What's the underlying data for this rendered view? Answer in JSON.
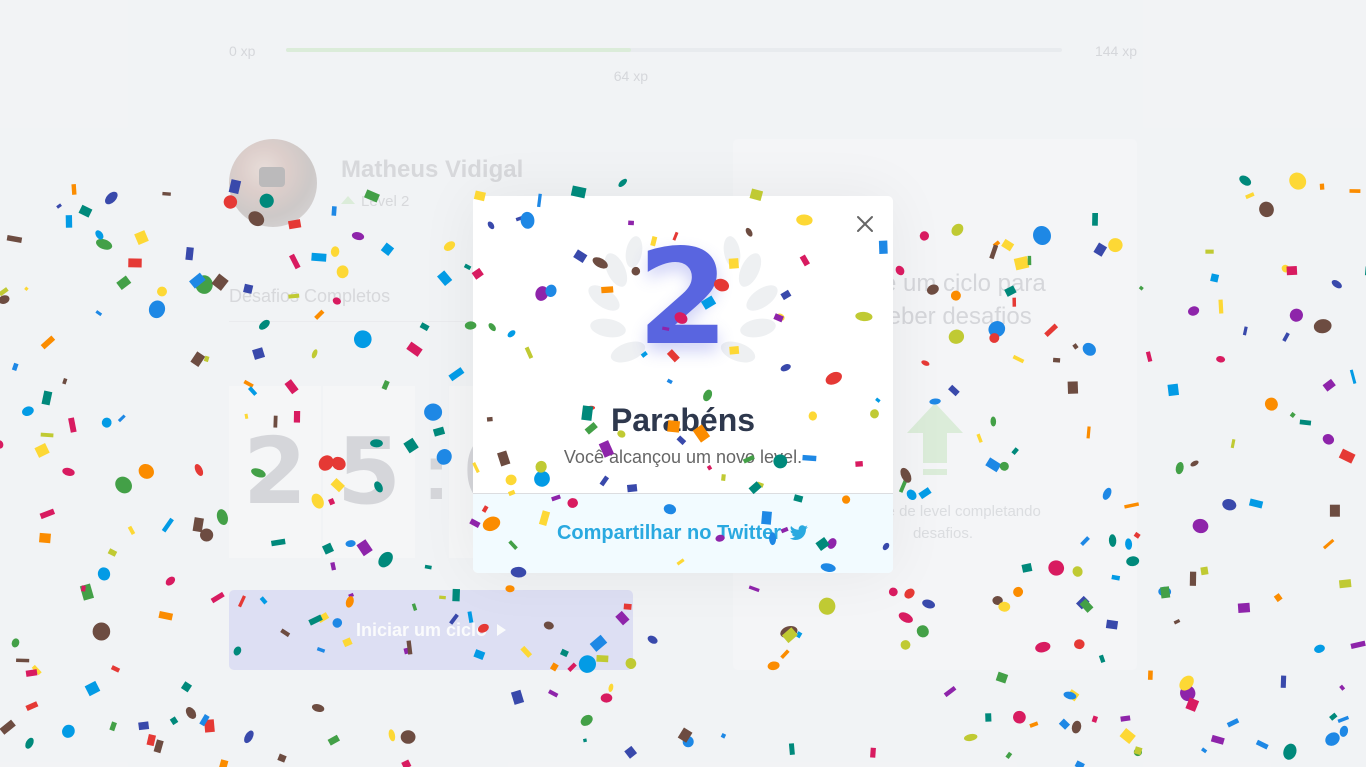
{
  "xp": {
    "min_label": "0 xp",
    "max_label": "144 xp",
    "current_label": "64 xp",
    "current": 64,
    "max": 144
  },
  "profile": {
    "name": "Matheus Vidigal",
    "level_label": "Level 2"
  },
  "completed": {
    "label": "Desafios Completos"
  },
  "countdown": {
    "digits": [
      "2",
      "5",
      ":",
      "0"
    ]
  },
  "start_button": {
    "label": "Iniciar um ciclo"
  },
  "challenge": {
    "text": "Inicie um ciclo para receber desafios",
    "hint": "Avance de level completando desafios."
  },
  "modal": {
    "level": "2",
    "title": "Parabéns",
    "subtitle": "Você alcançou um novo level.",
    "share_label": "Compartilhar no Twitter"
  },
  "colors": {
    "accent": "#5965e0",
    "twitter": "#2aa9e0",
    "xp_fill": "#cfe9c9",
    "title": "#2e384d"
  },
  "icons": {
    "close": "close-icon",
    "twitter": "twitter-icon",
    "level_up": "level-up-arrow-icon",
    "laurel": "laurel-icon",
    "play": "play-icon"
  }
}
